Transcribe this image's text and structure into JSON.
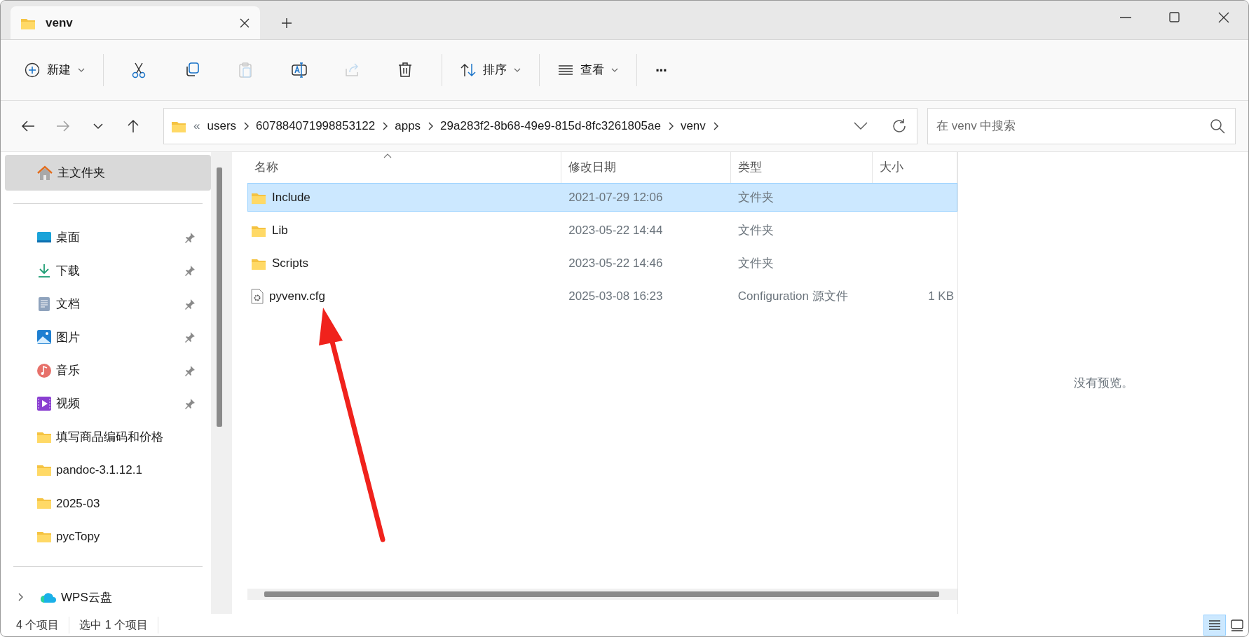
{
  "window": {
    "tabs": [
      {
        "title": "venv",
        "selected": true
      }
    ]
  },
  "toolbar": [
    {
      "kind": "menu",
      "label": "新建",
      "disabled": false
    },
    {
      "kind": "button",
      "disabled": false
    },
    {
      "kind": "button",
      "disabled": false
    },
    {
      "kind": "button",
      "disabled": true
    },
    {
      "kind": "button",
      "disabled": false
    },
    {
      "kind": "button",
      "disabled": true
    },
    {
      "kind": "button",
      "disabled": false
    },
    {
      "kind": "menu",
      "label": "排序",
      "disabled": false
    },
    {
      "kind": "menu",
      "label": "查看",
      "disabled": false
    },
    {
      "kind": "more",
      "label": "···",
      "disabled": false
    }
  ],
  "navigation": {
    "forward_disabled": true
  },
  "address": {
    "overflow": "«",
    "crumbs": [
      "users",
      "607884071998853122",
      "apps",
      "29a283f2-8b68-49e9-815d-8fc3261805ae",
      "venv"
    ]
  },
  "search": {
    "placeholder": "在 venv 中搜索"
  },
  "sidebar": {
    "home": {
      "label": "主文件夹",
      "selected": true
    },
    "items": [
      {
        "kind": "desktop",
        "label": "桌面",
        "pinned": true
      },
      {
        "kind": "downloads",
        "label": "下载",
        "pinned": true
      },
      {
        "kind": "documents",
        "label": "文档",
        "pinned": true
      },
      {
        "kind": "pictures",
        "label": "图片",
        "pinned": true
      },
      {
        "kind": "music",
        "label": "音乐",
        "pinned": true
      },
      {
        "kind": "videos",
        "label": "视频",
        "pinned": true
      },
      {
        "kind": "folder",
        "label": "填写商品编码和价格",
        "pinned": false
      },
      {
        "kind": "folder",
        "label": "pandoc-3.1.12.1",
        "pinned": false
      },
      {
        "kind": "folder",
        "label": "2025-03",
        "pinned": false
      },
      {
        "kind": "folder",
        "label": "pycTopy",
        "pinned": false
      }
    ],
    "cloud": {
      "label": "WPS云盘",
      "expanded": false
    }
  },
  "table": {
    "columns": [
      {
        "label": "名称",
        "sorted": true
      },
      {
        "label": "修改日期",
        "sorted": false
      },
      {
        "label": "类型",
        "sorted": false
      },
      {
        "label": "大小",
        "sorted": false
      }
    ],
    "rows": [
      {
        "kind": "folder",
        "name": "Include",
        "date": "2021-07-29 12:06",
        "type": "文件夹",
        "size": "",
        "selected": true
      },
      {
        "kind": "folder",
        "name": "Lib",
        "date": "2023-05-22 14:44",
        "type": "文件夹",
        "size": "",
        "selected": false
      },
      {
        "kind": "folder",
        "name": "Scripts",
        "date": "2023-05-22 14:46",
        "type": "文件夹",
        "size": "",
        "selected": false
      },
      {
        "kind": "file",
        "name": "pyvenv.cfg",
        "date": "2025-03-08 16:23",
        "type": "Configuration 源文件",
        "size": "1 KB",
        "selected": false
      }
    ]
  },
  "preview": {
    "text": "没有预览。"
  },
  "status_bar": {
    "texts": [
      "4 个项目",
      "选中 1 个项目"
    ],
    "views": [
      {
        "kind": "details",
        "selected": true
      },
      {
        "kind": "tiles",
        "selected": false
      }
    ]
  },
  "annotation": {
    "kind": "arrow"
  }
}
